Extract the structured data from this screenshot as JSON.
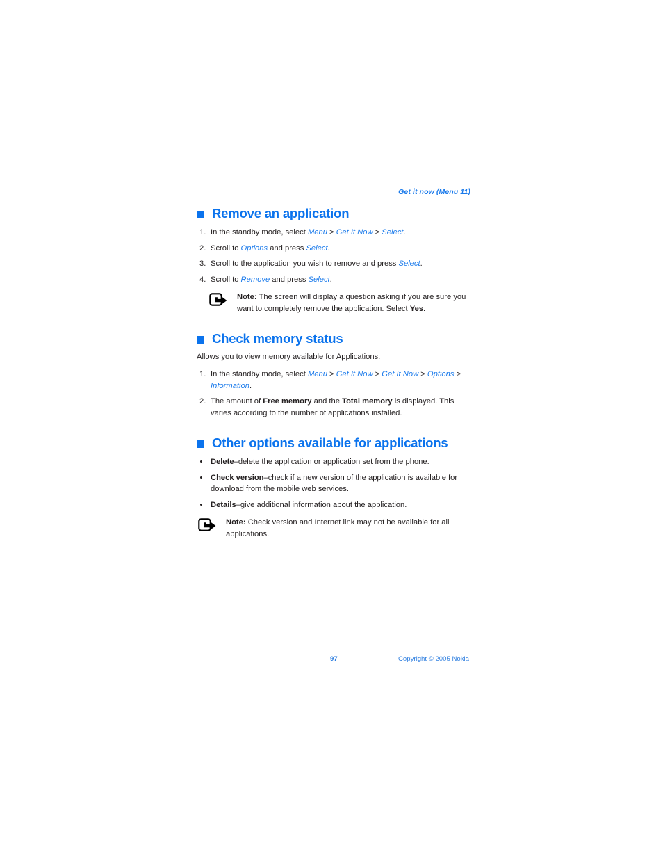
{
  "header": {
    "running_head": "Get it now (Menu 11)"
  },
  "sections": [
    {
      "id": "remove-an-application",
      "title": "Remove an application",
      "steps": [
        {
          "num": "1.",
          "parts": [
            {
              "t": "In the standby mode, select ",
              "s": "plain"
            },
            {
              "t": "Menu",
              "s": "menu"
            },
            {
              "t": " > ",
              "s": "sep"
            },
            {
              "t": "Get It Now",
              "s": "menu"
            },
            {
              "t": " > ",
              "s": "sep"
            },
            {
              "t": "Select",
              "s": "menu"
            },
            {
              "t": ".",
              "s": "plain"
            }
          ]
        },
        {
          "num": "2.",
          "parts": [
            {
              "t": "Scroll to ",
              "s": "plain"
            },
            {
              "t": "Options",
              "s": "menu"
            },
            {
              "t": " and press ",
              "s": "plain"
            },
            {
              "t": "Select",
              "s": "menu"
            },
            {
              "t": ".",
              "s": "plain"
            }
          ]
        },
        {
          "num": "3.",
          "parts": [
            {
              "t": "Scroll to the application you wish to remove and press ",
              "s": "plain"
            },
            {
              "t": "Select",
              "s": "menu"
            },
            {
              "t": ".",
              "s": "plain"
            }
          ]
        },
        {
          "num": "4.",
          "parts": [
            {
              "t": "Scroll to ",
              "s": "plain"
            },
            {
              "t": "Remove",
              "s": "menu"
            },
            {
              "t": " and press ",
              "s": "plain"
            },
            {
              "t": "Select",
              "s": "menu"
            },
            {
              "t": ".",
              "s": "plain"
            }
          ]
        }
      ],
      "note": {
        "icon": "note-arrow-icon",
        "parts": [
          {
            "t": "Note:",
            "s": "bold"
          },
          {
            "t": " The screen will display a question asking if you are sure you want to completely remove the application. Select ",
            "s": "plain"
          },
          {
            "t": "Yes",
            "s": "bold"
          },
          {
            "t": ".",
            "s": "plain"
          }
        ]
      }
    },
    {
      "id": "check-memory-status",
      "title": "Check memory status",
      "lead": "Allows you to view memory available for Applications.",
      "steps": [
        {
          "num": "1.",
          "parts": [
            {
              "t": "In the standby mode, select ",
              "s": "plain"
            },
            {
              "t": "Menu",
              "s": "menu"
            },
            {
              "t": " > ",
              "s": "sep"
            },
            {
              "t": "Get It Now",
              "s": "menu"
            },
            {
              "t": " > ",
              "s": "sep"
            },
            {
              "t": "Get It Now",
              "s": "menu"
            },
            {
              "t": " > ",
              "s": "sep"
            },
            {
              "t": "Options",
              "s": "menu"
            },
            {
              "t": " > ",
              "s": "sep"
            },
            {
              "t": "Information",
              "s": "menu"
            },
            {
              "t": ".",
              "s": "plain"
            }
          ]
        },
        {
          "num": "2.",
          "parts": [
            {
              "t": "The amount of ",
              "s": "plain"
            },
            {
              "t": "Free memory",
              "s": "bold"
            },
            {
              "t": " and the ",
              "s": "plain"
            },
            {
              "t": "Total memory",
              "s": "bold"
            },
            {
              "t": " is displayed. This varies according to the number of applications installed.",
              "s": "plain"
            }
          ]
        }
      ]
    },
    {
      "id": "other-options-available-for-applications",
      "title": "Other options available for applications",
      "bullets": [
        {
          "parts": [
            {
              "t": "Delete",
              "s": "bold"
            },
            {
              "t": "–delete the application or application set from the phone.",
              "s": "plain"
            }
          ]
        },
        {
          "parts": [
            {
              "t": "Check version",
              "s": "bold"
            },
            {
              "t": "–check if a new version of the application is available for download from the mobile web services.",
              "s": "plain"
            }
          ]
        },
        {
          "parts": [
            {
              "t": "Details",
              "s": "bold"
            },
            {
              "t": "–give additional information about the application.",
              "s": "plain"
            }
          ]
        }
      ],
      "note": {
        "icon": "note-arrow-icon",
        "parts": [
          {
            "t": "Note:",
            "s": "bold"
          },
          {
            "t": " Check version and Internet link may not be available for all applications.",
            "s": "plain"
          }
        ]
      }
    }
  ],
  "footer": {
    "page_number": "97",
    "copyright": "Copyright © 2005 Nokia"
  },
  "colors": {
    "heading_blue": "#0b73ed",
    "menu_blue": "#1a7aeb",
    "footer_blue": "#2f7fe0",
    "body_text": "#231f20"
  }
}
